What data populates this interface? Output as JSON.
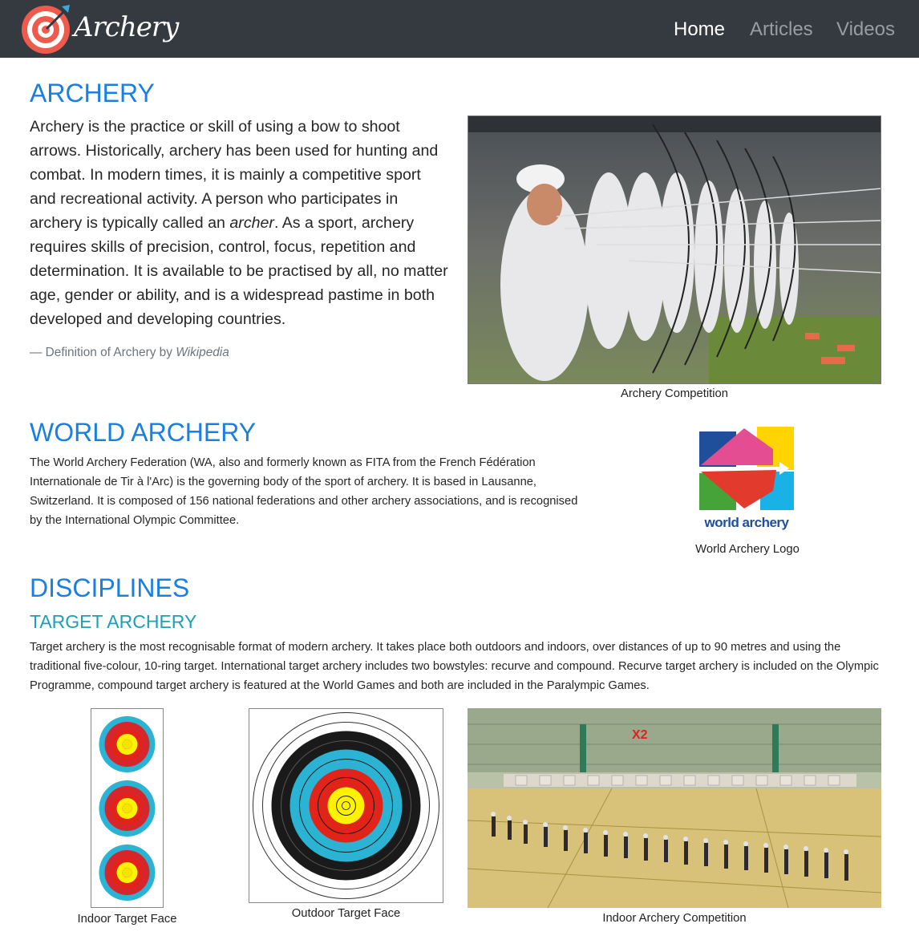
{
  "navbar": {
    "brand": "Archery",
    "links": [
      {
        "label": "Home",
        "active": true
      },
      {
        "label": "Articles",
        "active": false
      },
      {
        "label": "Videos",
        "active": false
      }
    ]
  },
  "archery": {
    "heading": "ARCHERY",
    "text_1": "Archery is the practice or skill of using a bow to shoot arrows. Historically, archery has been used for hunting and combat. In modern times, it is mainly a competitive sport and recreational activity. A person who participates in archery is typically called an ",
    "text_em": "archer",
    "text_2": ". As a sport, archery requires skills of precision, control, focus, repetition and determination. It is available to be practised by all, no matter age, gender or ability, and is a widespread pastime in both developed and developing countries.",
    "cite_prefix": "— Definition of Archery by ",
    "cite_source": "Wikipedia",
    "image_caption": "Archery Competition"
  },
  "world_archery": {
    "heading": "WORLD ARCHERY",
    "text": "The World Archery Federation (WA, also and formerly known as FITA from the French Fédération Internationale de Tir à l'Arc) is the governing body of the sport of archery. It is based in Lausanne, Switzerland. It is composed of 156 national federations and other archery associations, and is recognised by the International Olympic Committee.",
    "logo_wordmark": "world archery",
    "logo_caption": "World Archery Logo"
  },
  "disciplines": {
    "heading": "DISCIPLINES",
    "subheading": "TARGET ARCHERY",
    "text": "Target archery is the most recognisable format of modern archery. It takes place both outdoors and indoors, over distances of up to 90 metres and using the traditional five-colour, 10-ring target. International target archery includes two bowstyles: recurve and compound. Recurve target archery is included on the Olympic Programme, compound target archery is featured at the World Games and both are included in the Paralympic Games.",
    "captions": [
      "Indoor Target Face",
      "Outdoor Target Face",
      "Indoor Archery Competition"
    ],
    "hall_banner": "X2"
  },
  "colors": {
    "navbar_bg": "#343a40",
    "heading_blue": "#1a7fe0",
    "subheading_teal": "#1ba0b4",
    "target_gold": "#fff200",
    "target_red": "#e2231a",
    "target_blue": "#2bb3d4",
    "target_black": "#1a1a1a"
  },
  "icons": [
    "archery-target-logo-icon"
  ]
}
